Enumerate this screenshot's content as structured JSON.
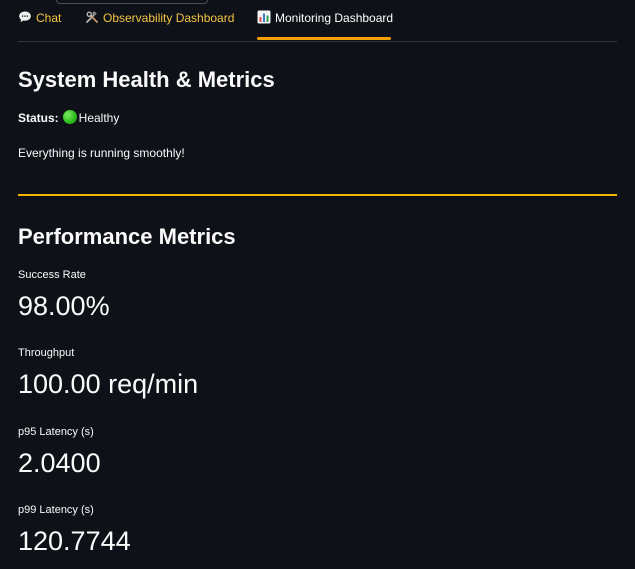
{
  "tabs": [
    {
      "label": "Chat",
      "icon": "speech-bubble-icon",
      "active": false
    },
    {
      "label": "Observability Dashboard",
      "icon": "hammer-and-wrench-icon",
      "active": false
    },
    {
      "label": "Monitoring Dashboard",
      "icon": "bar-chart-icon",
      "active": true
    }
  ],
  "health": {
    "title": "System Health & Metrics",
    "status_label": "Status:",
    "status_value": "Healthy",
    "status_color": "#2fbf1f",
    "message": "Everything is running smoothly!"
  },
  "performance": {
    "title": "Performance Metrics",
    "metrics": [
      {
        "label": "Success Rate",
        "value": "98.00%"
      },
      {
        "label": "Throughput",
        "value": "100.00 req/min"
      },
      {
        "label": "p95 Latency (s)",
        "value": "2.0400"
      },
      {
        "label": "p99 Latency (s)",
        "value": "120.7744"
      }
    ]
  },
  "colors": {
    "background": "#0e1117",
    "accent": "#f4b400",
    "tab_text": "#f4c542"
  }
}
